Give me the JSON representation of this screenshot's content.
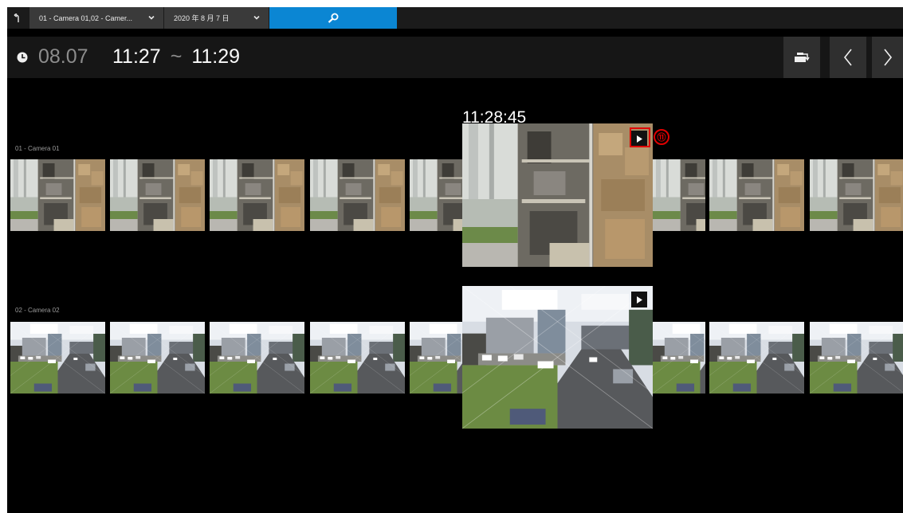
{
  "query_bar": {
    "camera_select_value": "01 - Camera 01,02 - Camer...",
    "date_select_value": "2020 年 8 月 7 日"
  },
  "time_header": {
    "date": "08.07",
    "start_time": "11:27",
    "separator": "~",
    "end_time": "11:29"
  },
  "cameras": [
    {
      "label": "01 - Camera 01"
    },
    {
      "label": "02 - Camera 02"
    }
  ],
  "preview": {
    "timestamp": "11:28:45"
  },
  "annotation": {
    "callout_number": "⑪"
  },
  "colors": {
    "accent": "#0b86d3",
    "callout": "#e00000"
  },
  "icons": [
    "back-icon",
    "chevron-down-icon",
    "search-icon",
    "clock-icon",
    "export-icon",
    "chevron-left-icon",
    "chevron-right-icon",
    "play-icon"
  ]
}
